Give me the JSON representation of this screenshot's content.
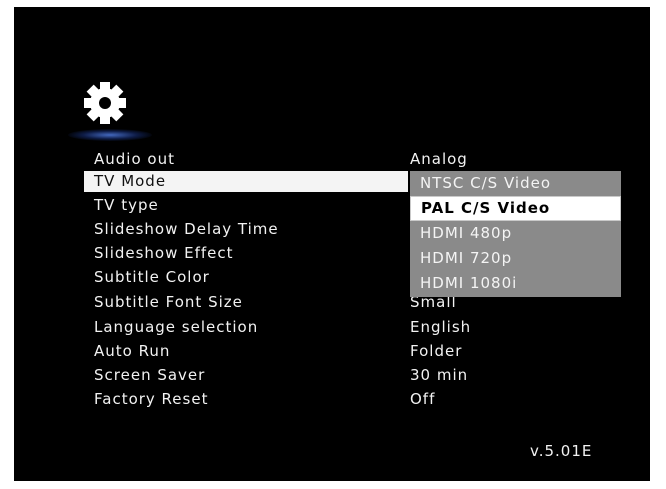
{
  "menu": {
    "items": [
      {
        "label": "Audio out",
        "value": "Analog"
      },
      {
        "label": "TV Mode",
        "value": ""
      },
      {
        "label": "TV type",
        "value": ""
      },
      {
        "label": "Slideshow Delay Time",
        "value": ""
      },
      {
        "label": "Slideshow Effect",
        "value": ""
      },
      {
        "label": "Subtitle Color",
        "value": ""
      },
      {
        "label": "Subtitle Font Size",
        "value": "Small"
      },
      {
        "label": "Language selection",
        "value": "English"
      },
      {
        "label": "Auto Run",
        "value": "Folder"
      },
      {
        "label": "Screen Saver",
        "value": "30 min"
      },
      {
        "label": "Factory Reset",
        "value": "Off"
      }
    ],
    "selected_index": 1
  },
  "dropdown": {
    "options": [
      "NTSC C/S Video",
      "PAL C/S Video",
      "HDMI 480p",
      "HDMI 720p",
      "HDMI 1080i"
    ],
    "highlighted_index": 1
  },
  "footer": {
    "version": "v.5.01E"
  },
  "icons": {
    "settings": "gear-icon"
  },
  "colors": {
    "background": "#000000",
    "text": "#f2f2f2",
    "selection_bar": "#f4f4f4",
    "dropdown_bg": "#8a8a8a",
    "dropdown_highlight": "#ffffff",
    "gear_glow": "#5a8cff"
  }
}
